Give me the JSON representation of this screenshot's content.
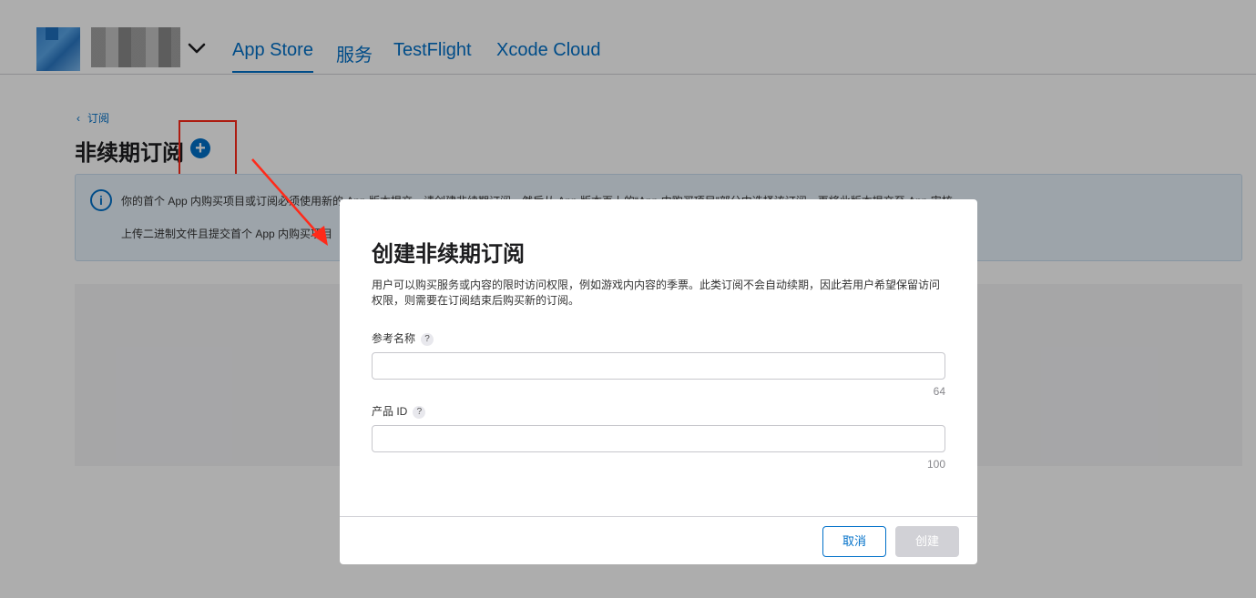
{
  "nav": {
    "tabs": [
      {
        "label": "App Store",
        "active": true
      },
      {
        "label": "服务",
        "active": false
      },
      {
        "label": "TestFlight",
        "active": false
      },
      {
        "label": "Xcode Cloud",
        "active": false
      }
    ]
  },
  "page": {
    "back_label": "订阅",
    "title": "非续期订阅",
    "info_line1": "你的首个 App 内购买项目或订阅必须使用新的 App 版本提交。请创建非续期订阅，然后从 App 版本页上的“App 内购买项目”部分中选择该订阅，再将此版本提交至 App 审核。",
    "info_line2": "上传二进制文件且提交首个 App 内购买项目"
  },
  "modal": {
    "title": "创建非续期订阅",
    "description": "用户可以购买服务或内容的限时访问权限，例如游戏内内容的季票。此类订阅不会自动续期，因此若用户希望保留访问权限，则需要在订阅结束后购买新的订阅。",
    "reference_name": {
      "label": "参考名称",
      "value": "",
      "max_length": "64"
    },
    "product_id": {
      "label": "产品 ID",
      "value": "",
      "max_length": "100"
    },
    "help_glyph": "?",
    "cancel_label": "取消",
    "create_label": "创建"
  },
  "colors": {
    "accent": "#0070c9",
    "annotation": "#ff2a1a",
    "disabled": "#d1d1d6"
  }
}
